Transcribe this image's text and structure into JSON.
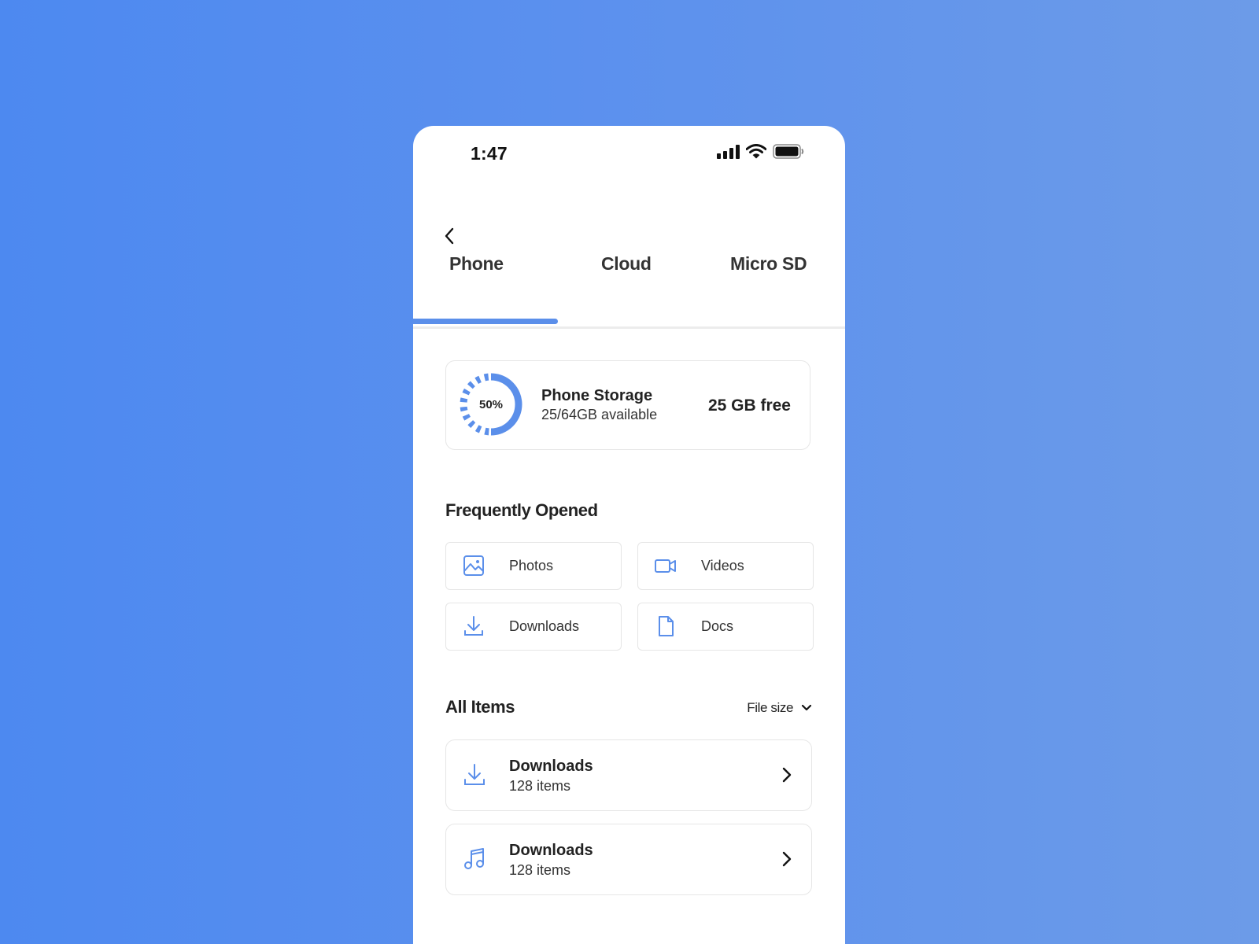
{
  "status_bar": {
    "time": "1:47",
    "icons": [
      "signal-icon",
      "wifi-icon",
      "battery-icon"
    ]
  },
  "nav": {
    "back_icon": "chevron-left-icon"
  },
  "tabs": [
    {
      "label": "Phone",
      "active": true
    },
    {
      "label": "Cloud",
      "active": false
    },
    {
      "label": "Micro SD",
      "active": false
    }
  ],
  "storage": {
    "percent_label": "50%",
    "used_fraction": 0.5,
    "title": "Phone Storage",
    "subtitle": "25/64GB available",
    "free": "25 GB free"
  },
  "frequently_opened": {
    "title": "Frequently Opened",
    "items": [
      {
        "label": "Photos",
        "icon": "image-icon"
      },
      {
        "label": "Videos",
        "icon": "video-icon"
      },
      {
        "label": "Downloads",
        "icon": "download-icon"
      },
      {
        "label": "Docs",
        "icon": "document-icon"
      }
    ]
  },
  "all_items": {
    "title": "All Items",
    "sort_label": "File size",
    "rows": [
      {
        "name": "Downloads",
        "count": "128 items",
        "icon": "download-icon"
      },
      {
        "name": "Downloads",
        "count": "128 items",
        "icon": "music-icon"
      }
    ]
  },
  "colors": {
    "accent": "#5b8fea",
    "background_start": "#4d89f0",
    "background_end": "#6c9be8"
  }
}
